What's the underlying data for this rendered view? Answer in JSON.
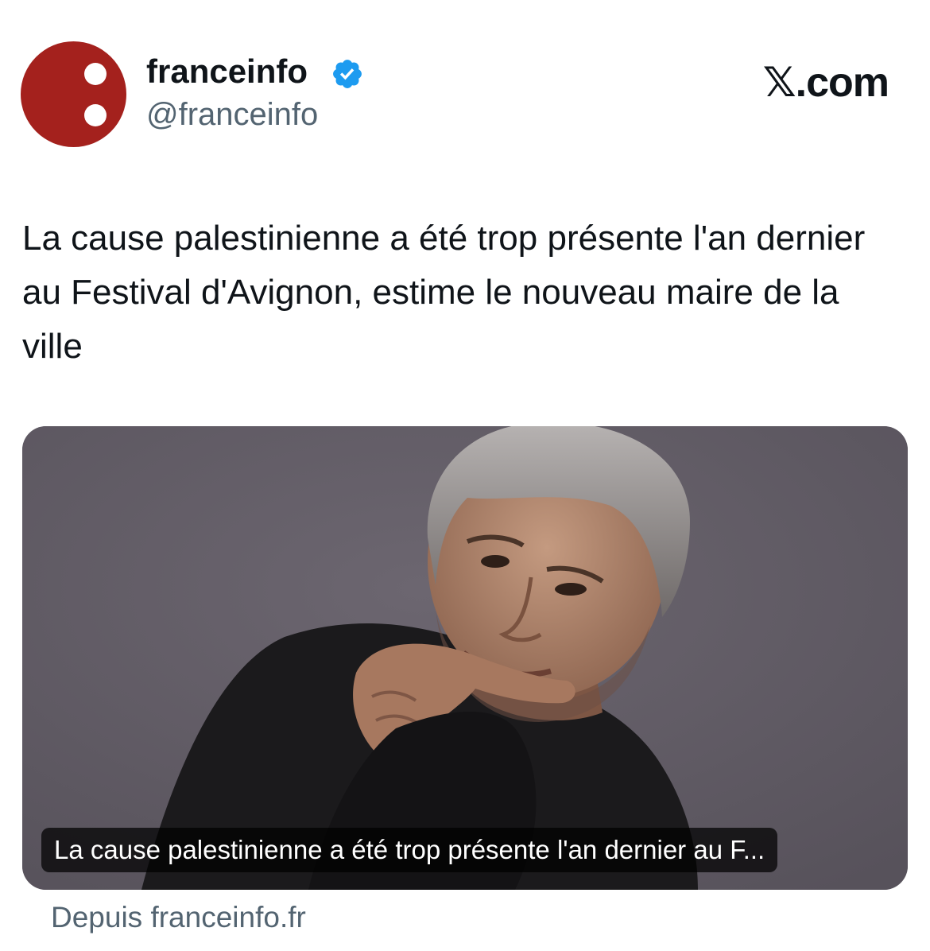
{
  "author": {
    "name": "franceinfo",
    "handle": "@franceinfo",
    "verified_icon": "verified-badge-icon",
    "avatar_color": "#a4211d"
  },
  "source_logo": {
    "glyph": "𝕏",
    "text": ".com"
  },
  "post": {
    "text": "La cause palestinienne a été trop présente l'an dernier au Festival d'Avignon, estime le nouveau maire de la ville"
  },
  "media": {
    "caption": "La cause palestinienne a été trop présente l'an dernier au F..."
  },
  "link": {
    "source": "Depuis franceinfo.fr"
  },
  "colors": {
    "text_primary": "#0f1419",
    "text_secondary": "#536471",
    "verified_blue": "#1d9bf0",
    "background_photo": "#625d66"
  }
}
